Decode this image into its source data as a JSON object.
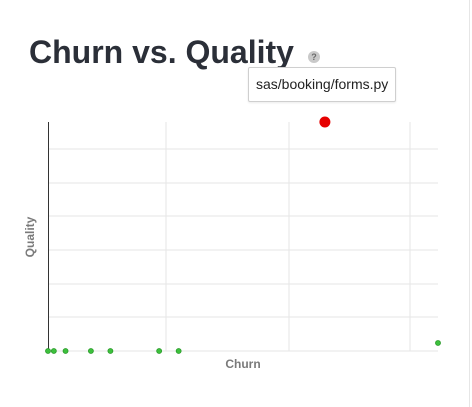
{
  "page": {
    "title": "Churn vs. Quality",
    "help_icon_label": "?"
  },
  "tooltip": {
    "text": "sas/booking/forms.py"
  },
  "chart_data": {
    "type": "scatter",
    "title": "Churn vs. Quality",
    "xlabel": "Churn",
    "ylabel": "Quality",
    "grid": true,
    "xlim": [
      0,
      100
    ],
    "ylim": [
      0,
      100
    ],
    "colors": {
      "point": "#3cc03c",
      "point_stroke": "#2a9a2a",
      "highlight": "#e60000",
      "grid": "#e6e6e6",
      "axis": "#333333"
    },
    "series": [
      {
        "points": [
          {
            "x": 0.0,
            "y": 0
          },
          {
            "x": 1.5,
            "y": 0
          },
          {
            "x": 4.5,
            "y": 0
          },
          {
            "x": 11,
            "y": 0
          },
          {
            "x": 16,
            "y": 0
          },
          {
            "x": 28.5,
            "y": 0
          },
          {
            "x": 33.5,
            "y": 0
          },
          {
            "x": 100,
            "y": 3.5
          }
        ]
      },
      {
        "highlight": true,
        "points": [
          {
            "x": 71,
            "y": 100,
            "label": "sas/booking/forms.py"
          }
        ]
      }
    ]
  }
}
